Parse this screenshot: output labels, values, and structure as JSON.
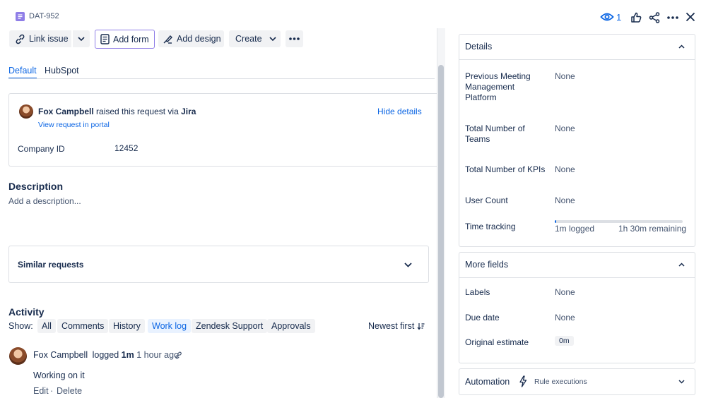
{
  "header": {
    "issue_key": "DAT-952",
    "watch_count": "1"
  },
  "toolbar": {
    "link_issue": "Link issue",
    "add_form": "Add form",
    "add_design": "Add design",
    "create": "Create"
  },
  "tabs": [
    "Default",
    "HubSpot"
  ],
  "request": {
    "requester": "Fox Campbell",
    "raised_text": "raised this request via",
    "channel": "Jira",
    "view_portal": "View request in portal",
    "hide_details": "Hide details",
    "company_label": "Company ID",
    "company_value": "12452"
  },
  "description": {
    "title": "Description",
    "placeholder": "Add a description..."
  },
  "similar": {
    "title": "Similar requests"
  },
  "activity": {
    "title": "Activity",
    "show_label": "Show:",
    "filters": [
      "All",
      "Comments",
      "History",
      "Work log",
      "Zendesk Support",
      "Approvals"
    ],
    "selected_filter": "Work log",
    "sort": "Newest first",
    "entry": {
      "author": "Fox Campbell",
      "action": "logged",
      "duration": "1m",
      "time": "1 hour ago",
      "comment": "Working on it",
      "edit": "Edit",
      "separator": "·",
      "delete": "Delete"
    }
  },
  "details": {
    "title": "Details",
    "fields": [
      {
        "label": "Previous Meeting Management Platform",
        "value": "None"
      },
      {
        "label": "Total Number of Teams",
        "value": "None"
      },
      {
        "label": "Total Number of KPIs",
        "value": "None"
      },
      {
        "label": "User Count",
        "value": "None"
      }
    ],
    "time_tracking": {
      "label": "Time tracking",
      "logged": "1m logged",
      "remaining": "1h 30m remaining",
      "progress_fraction": 0.011
    }
  },
  "more_fields": {
    "title": "More fields",
    "labels_label": "Labels",
    "labels_value": "None",
    "due_label": "Due date",
    "due_value": "None",
    "estimate_label": "Original estimate",
    "estimate_value": "0m"
  },
  "automation": {
    "title": "Automation",
    "rule_executions": "Rule executions"
  },
  "colors": {
    "accent": "#0c66e4",
    "issue_icon": "#8f7ee7",
    "border": "#dcdfe4",
    "tab_active": "#0c66e4"
  }
}
